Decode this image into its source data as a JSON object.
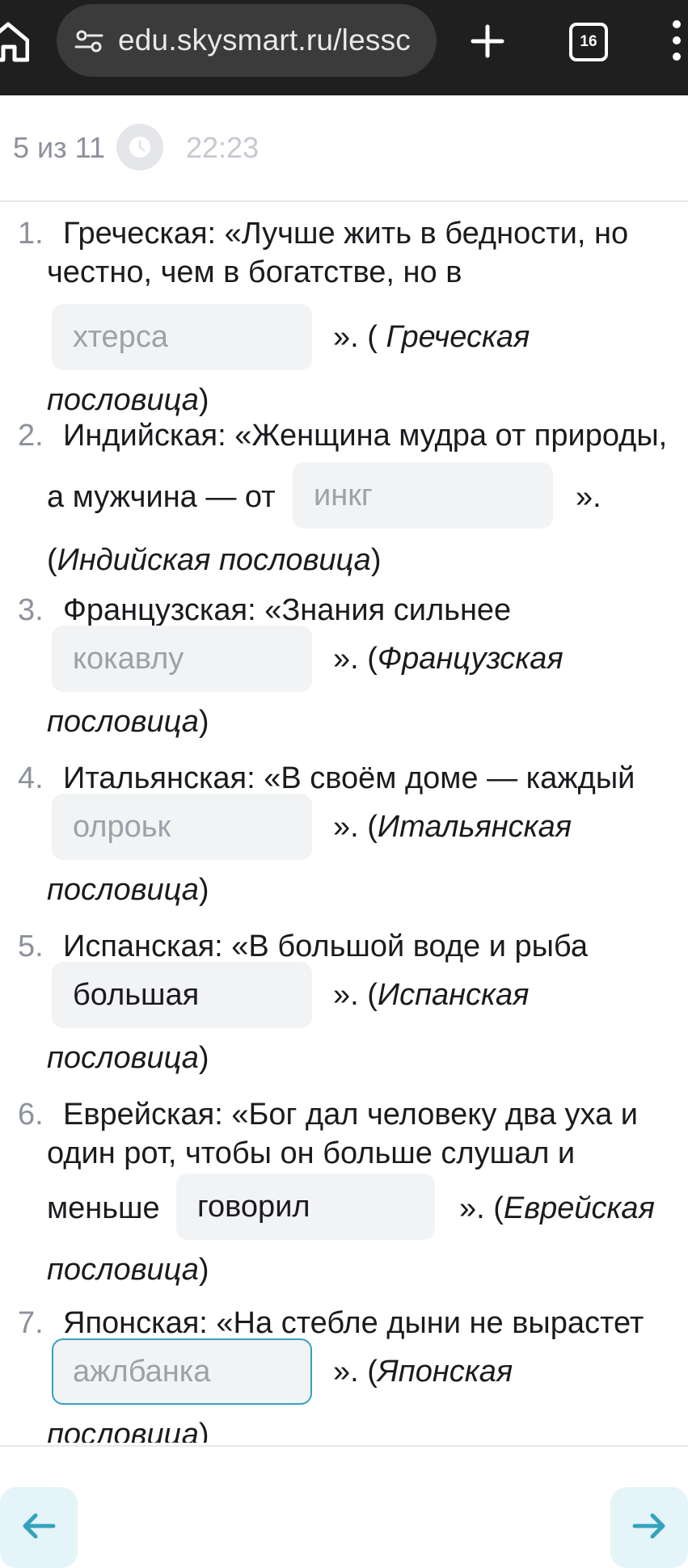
{
  "browser": {
    "url": "edu.skysmart.ru/lessc",
    "tab_count": "16"
  },
  "lesson": {
    "progress": "5 из 11",
    "timer": "22:23"
  },
  "items": [
    {
      "num": "1.",
      "line1": "Греческая: «Лучше жить в бедности, но",
      "line2": "честно, чем в богатстве, но в",
      "answer": "хтерса",
      "after": "». ( ",
      "after_italic": "Греческая",
      "tail_italic": "пословица",
      "tail": ")"
    },
    {
      "num": "2.",
      "line1": "Индийская: «Женщина мудра от природы,",
      "before": "а мужчина — от",
      "answer": "инкг",
      "after": "».",
      "tail_open": "(",
      "tail_italic": "Индийская пословица",
      "tail": ")"
    },
    {
      "num": "3.",
      "line1": "Французская: «Знания сильнее",
      "answer": "кокавлу",
      "after": "». (",
      "after_italic": "Французская",
      "tail_italic": "пословица",
      "tail": ")"
    },
    {
      "num": "4.",
      "line1": "Итальянская: «В своём доме — каждый",
      "answer": "олроьк",
      "after": "». (",
      "after_italic": "Итальянская",
      "tail_italic": "пословица",
      "tail": ")"
    },
    {
      "num": "5.",
      "line1": "Испанская: «В большой воде и рыба",
      "answer": "большая",
      "after": "». (",
      "after_italic": "Испанская",
      "tail_italic": "пословица",
      "tail": ")"
    },
    {
      "num": "6.",
      "line1": "Еврейская: «Бог дал человеку два уха и",
      "line2": "один рот, чтобы он больше слушал и",
      "before": "меньше",
      "answer": "говорил",
      "after": "». (",
      "after_italic": "Еврейская",
      "tail_italic": "пословица",
      "tail": ")"
    },
    {
      "num": "7.",
      "line1": "Японская: «На стебле дыни не вырастет",
      "answer": "ажлбанка",
      "after": "». (",
      "after_italic": "Японская",
      "tail_italic": "пословица",
      "tail": ")"
    }
  ],
  "icons": {
    "home": "home-icon",
    "site_settings": "tune-icon",
    "new_tab": "plus-icon",
    "menu": "more-vert-icon",
    "timer": "clock-icon",
    "back": "arrow-left-icon",
    "forward": "arrow-right-icon"
  },
  "colors": {
    "accent": "#34a2bf",
    "input_bg": "#f2f3f5",
    "nav_button_bg": "#e4f4f8"
  }
}
